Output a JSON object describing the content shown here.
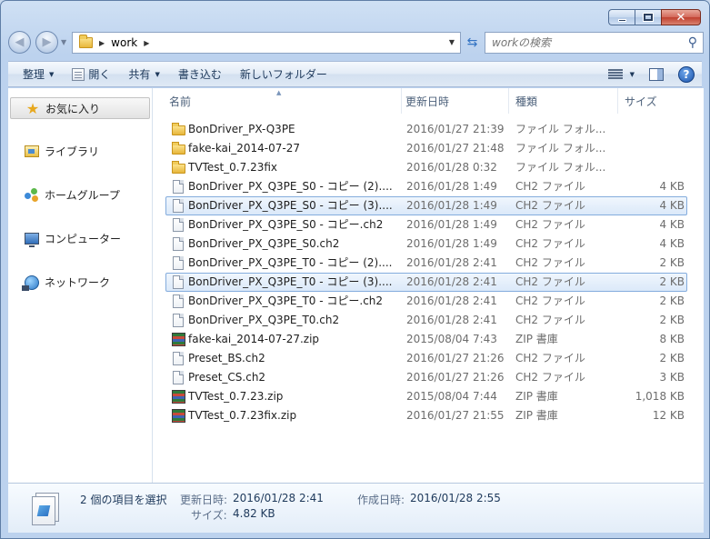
{
  "window": {
    "caption": {
      "minimize": "minimize",
      "maximize": "maximize",
      "close": "✕"
    }
  },
  "address": {
    "path": "work",
    "search_placeholder": "workの検索"
  },
  "toolbar": {
    "organize": "整理",
    "open": "開く",
    "share": "共有",
    "burn": "書き込む",
    "new_folder": "新しいフォルダー",
    "help": "?"
  },
  "nav": {
    "favorites": "お気に入り",
    "libraries": "ライブラリ",
    "homegroup": "ホームグループ",
    "computer": "コンピューター",
    "network": "ネットワーク"
  },
  "columns": {
    "name": "名前",
    "date": "更新日時",
    "type": "種類",
    "size": "サイズ"
  },
  "files": [
    {
      "icon": "folder",
      "name": "BonDriver_PX-Q3PE",
      "date": "2016/01/27 21:39",
      "type": "ファイル フォル...",
      "size": "",
      "selected": false
    },
    {
      "icon": "folder",
      "name": "fake-kai_2014-07-27",
      "date": "2016/01/27 21:48",
      "type": "ファイル フォル...",
      "size": "",
      "selected": false
    },
    {
      "icon": "folder",
      "name": "TVTest_0.7.23fix",
      "date": "2016/01/28 0:32",
      "type": "ファイル フォル...",
      "size": "",
      "selected": false
    },
    {
      "icon": "doc",
      "name": "BonDriver_PX_Q3PE_S0 - コピー (2)....",
      "date": "2016/01/28 1:49",
      "type": "CH2 ファイル",
      "size": "4 KB",
      "selected": false
    },
    {
      "icon": "doc",
      "name": "BonDriver_PX_Q3PE_S0 - コピー (3)....",
      "date": "2016/01/28 1:49",
      "type": "CH2 ファイル",
      "size": "4 KB",
      "selected": true
    },
    {
      "icon": "doc",
      "name": "BonDriver_PX_Q3PE_S0 - コピー.ch2",
      "date": "2016/01/28 1:49",
      "type": "CH2 ファイル",
      "size": "4 KB",
      "selected": false
    },
    {
      "icon": "doc",
      "name": "BonDriver_PX_Q3PE_S0.ch2",
      "date": "2016/01/28 1:49",
      "type": "CH2 ファイル",
      "size": "4 KB",
      "selected": false
    },
    {
      "icon": "doc",
      "name": "BonDriver_PX_Q3PE_T0 - コピー (2)....",
      "date": "2016/01/28 2:41",
      "type": "CH2 ファイル",
      "size": "2 KB",
      "selected": false
    },
    {
      "icon": "doc",
      "name": "BonDriver_PX_Q3PE_T0 - コピー (3)....",
      "date": "2016/01/28 2:41",
      "type": "CH2 ファイル",
      "size": "2 KB",
      "selected": true
    },
    {
      "icon": "doc",
      "name": "BonDriver_PX_Q3PE_T0 - コピー.ch2",
      "date": "2016/01/28 2:41",
      "type": "CH2 ファイル",
      "size": "2 KB",
      "selected": false
    },
    {
      "icon": "doc",
      "name": "BonDriver_PX_Q3PE_T0.ch2",
      "date": "2016/01/28 2:41",
      "type": "CH2 ファイル",
      "size": "2 KB",
      "selected": false
    },
    {
      "icon": "zip",
      "name": "fake-kai_2014-07-27.zip",
      "date": "2015/08/04 7:43",
      "type": "ZIP 書庫",
      "size": "8 KB",
      "selected": false
    },
    {
      "icon": "doc",
      "name": "Preset_BS.ch2",
      "date": "2016/01/27 21:26",
      "type": "CH2 ファイル",
      "size": "2 KB",
      "selected": false
    },
    {
      "icon": "doc",
      "name": "Preset_CS.ch2",
      "date": "2016/01/27 21:26",
      "type": "CH2 ファイル",
      "size": "3 KB",
      "selected": false
    },
    {
      "icon": "zip",
      "name": "TVTest_0.7.23.zip",
      "date": "2015/08/04 7:44",
      "type": "ZIP 書庫",
      "size": "1,018 KB",
      "selected": false
    },
    {
      "icon": "zip",
      "name": "TVTest_0.7.23fix.zip",
      "date": "2016/01/27 21:55",
      "type": "ZIP 書庫",
      "size": "12 KB",
      "selected": false
    }
  ],
  "details": {
    "selection": "2 個の項目を選択",
    "modified_label": "更新日時:",
    "modified_value": "2016/01/28 2:41",
    "created_label": "作成日時:",
    "created_value": "2016/01/28 2:55",
    "size_label": "サイズ:",
    "size_value": "4.82 KB"
  }
}
